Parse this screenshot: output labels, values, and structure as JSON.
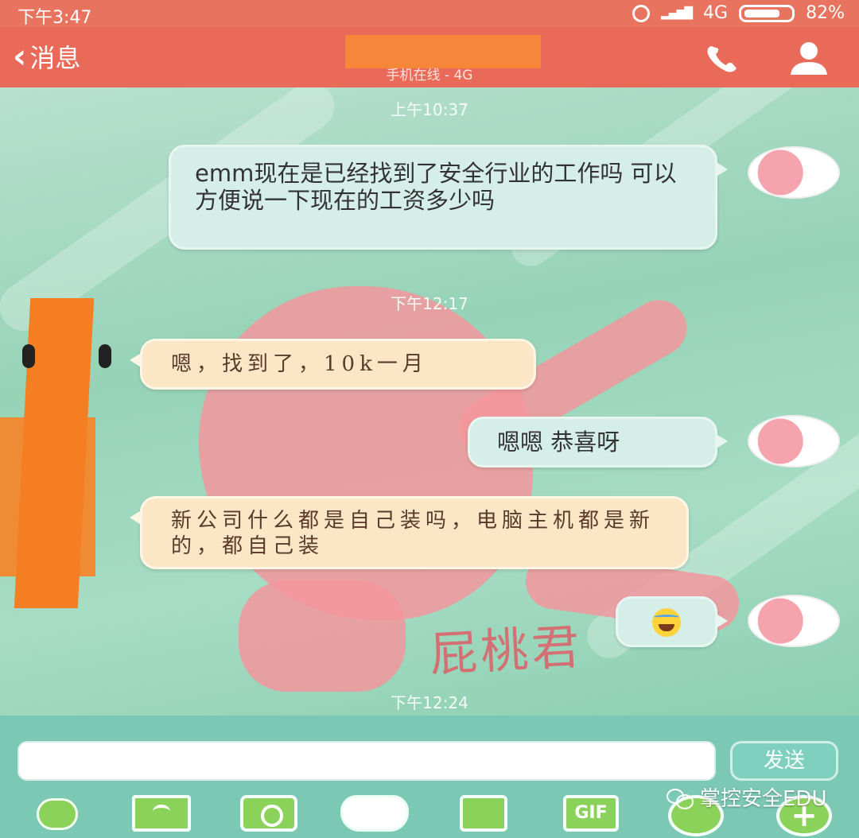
{
  "status_bar": {
    "time": "下午3:47",
    "network": "4G",
    "battery": "82%"
  },
  "header": {
    "back_label": "消息",
    "subtitle": "手机在线 - 4G"
  },
  "messages": {
    "ts1": "上午10:37",
    "msg1": "emm现在是已经找到了安全行业的工作吗 可以方便说一下现在的工资多少吗",
    "ts2": "下午12:17",
    "msg2": "嗯，找到了，10k一月",
    "msg3": "嗯嗯  恭喜呀",
    "msg4": "新公司什么都是自己装吗，电脑主机都是新的，都自己装",
    "ts3": "下午12:24"
  },
  "background_text": "屁桃君",
  "input_bar": {
    "send_label": "发送",
    "gif_label": "GIF"
  },
  "watermark": "掌控安全EDU",
  "colors": {
    "header": "#e96a58",
    "chat_bg": "#a8d9c2",
    "my_bubble": "#d6eee8",
    "their_bubble": "#fbe6c6",
    "redaction": "#f57d22"
  }
}
